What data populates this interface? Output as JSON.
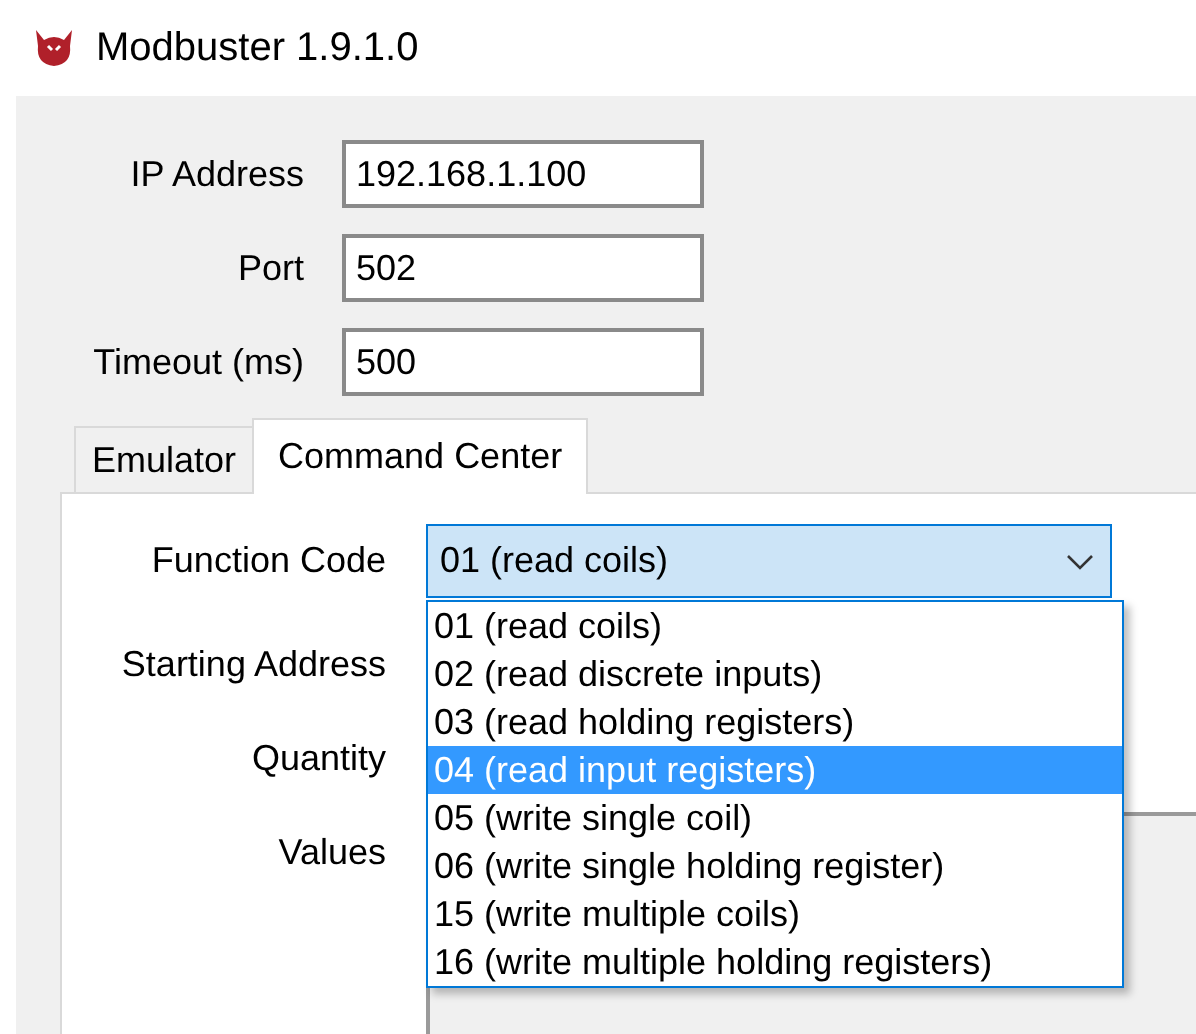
{
  "window": {
    "title": "Modbuster 1.9.1.0"
  },
  "connection": [
    {
      "label": "IP Address",
      "value": "192.168.1.100"
    },
    {
      "label": "Port",
      "value": "502"
    },
    {
      "label": "Timeout (ms)",
      "value": "500"
    }
  ],
  "tabs": [
    {
      "label": "Emulator",
      "selected": false
    },
    {
      "label": "Command Center",
      "selected": true
    }
  ],
  "command": {
    "function_code": {
      "label": "Function Code",
      "value": "01 (read coils)",
      "expanded": true,
      "options": [
        {
          "label": "01 (read coils)",
          "highlighted": false
        },
        {
          "label": "02 (read discrete inputs)",
          "highlighted": false
        },
        {
          "label": "03 (read holding registers)",
          "highlighted": false
        },
        {
          "label": "04 (read input registers)",
          "highlighted": true
        },
        {
          "label": "05 (write single coil)",
          "highlighted": false
        },
        {
          "label": "06 (write single holding register)",
          "highlighted": false
        },
        {
          "label": "15 (write multiple coils)",
          "highlighted": false
        },
        {
          "label": "16 (write multiple holding registers)",
          "highlighted": false
        }
      ]
    },
    "labels": [
      "Starting Address",
      "Quantity",
      "Values"
    ]
  }
}
